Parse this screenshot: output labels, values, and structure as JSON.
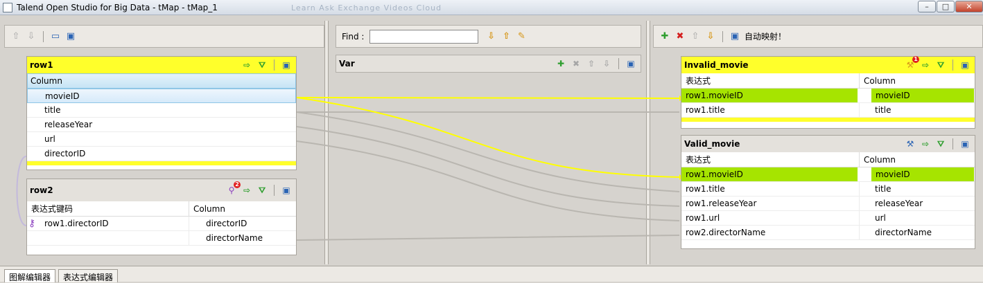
{
  "window": {
    "title": "Talend Open Studio for Big Data - tMap - tMap_1",
    "ghost_text": "Learn   Ask   Exchange   Videos   Cloud"
  },
  "window_controls": {
    "minimize": "–",
    "maximize": "□",
    "close": "✕"
  },
  "left_toolbar": {
    "up": "⇧",
    "down": "⇩",
    "view1": "▭",
    "view2": "▣"
  },
  "middle_toolbar": {
    "find_label": "Find :",
    "find_value": "",
    "down": "⇩",
    "up": "⇧",
    "wand": "✎"
  },
  "right_toolbar": {
    "add": "✚",
    "remove": "✖",
    "up": "⇧",
    "down": "⇩",
    "view": "▣",
    "auto_map": "自动映射！"
  },
  "row1": {
    "title": "row1",
    "column_header": "Column",
    "rows": [
      "movieID",
      "title",
      "releaseYear",
      "url",
      "directorID"
    ]
  },
  "row2": {
    "title": "row2",
    "header_expr": "表达式键码",
    "header_col": "Column",
    "rows": [
      {
        "expr": "row1.directorID",
        "col": "directorID"
      },
      {
        "expr": "",
        "col": "directorName"
      }
    ]
  },
  "var": {
    "title": "Var"
  },
  "invalid_movie": {
    "title": "Invalid_movie",
    "header_expr": "表达式",
    "header_col": "Column",
    "rows": [
      {
        "expr": "row1.movieID",
        "col": "movieID"
      },
      {
        "expr": "row1.title",
        "col": "title"
      }
    ]
  },
  "valid_movie": {
    "title": "Valid_movie",
    "header_expr": "表达式",
    "header_col": "Column",
    "rows": [
      {
        "expr": "row1.movieID",
        "col": "movieID"
      },
      {
        "expr": "row1.title",
        "col": "title"
      },
      {
        "expr": "row1.releaseYear",
        "col": "releaseYear"
      },
      {
        "expr": "row1.url",
        "col": "url"
      },
      {
        "expr": "row2.directorName",
        "col": "directorName"
      }
    ]
  },
  "badges": {
    "row2_key": "2",
    "invalid_key": "1"
  },
  "bottom_tabs": [
    "图解编辑器",
    "表达式编辑器"
  ],
  "colors": {
    "highlight_yellow": "#ffff2b",
    "mapped_green": "#a6e400",
    "link_gray": "#b9b6b0"
  }
}
